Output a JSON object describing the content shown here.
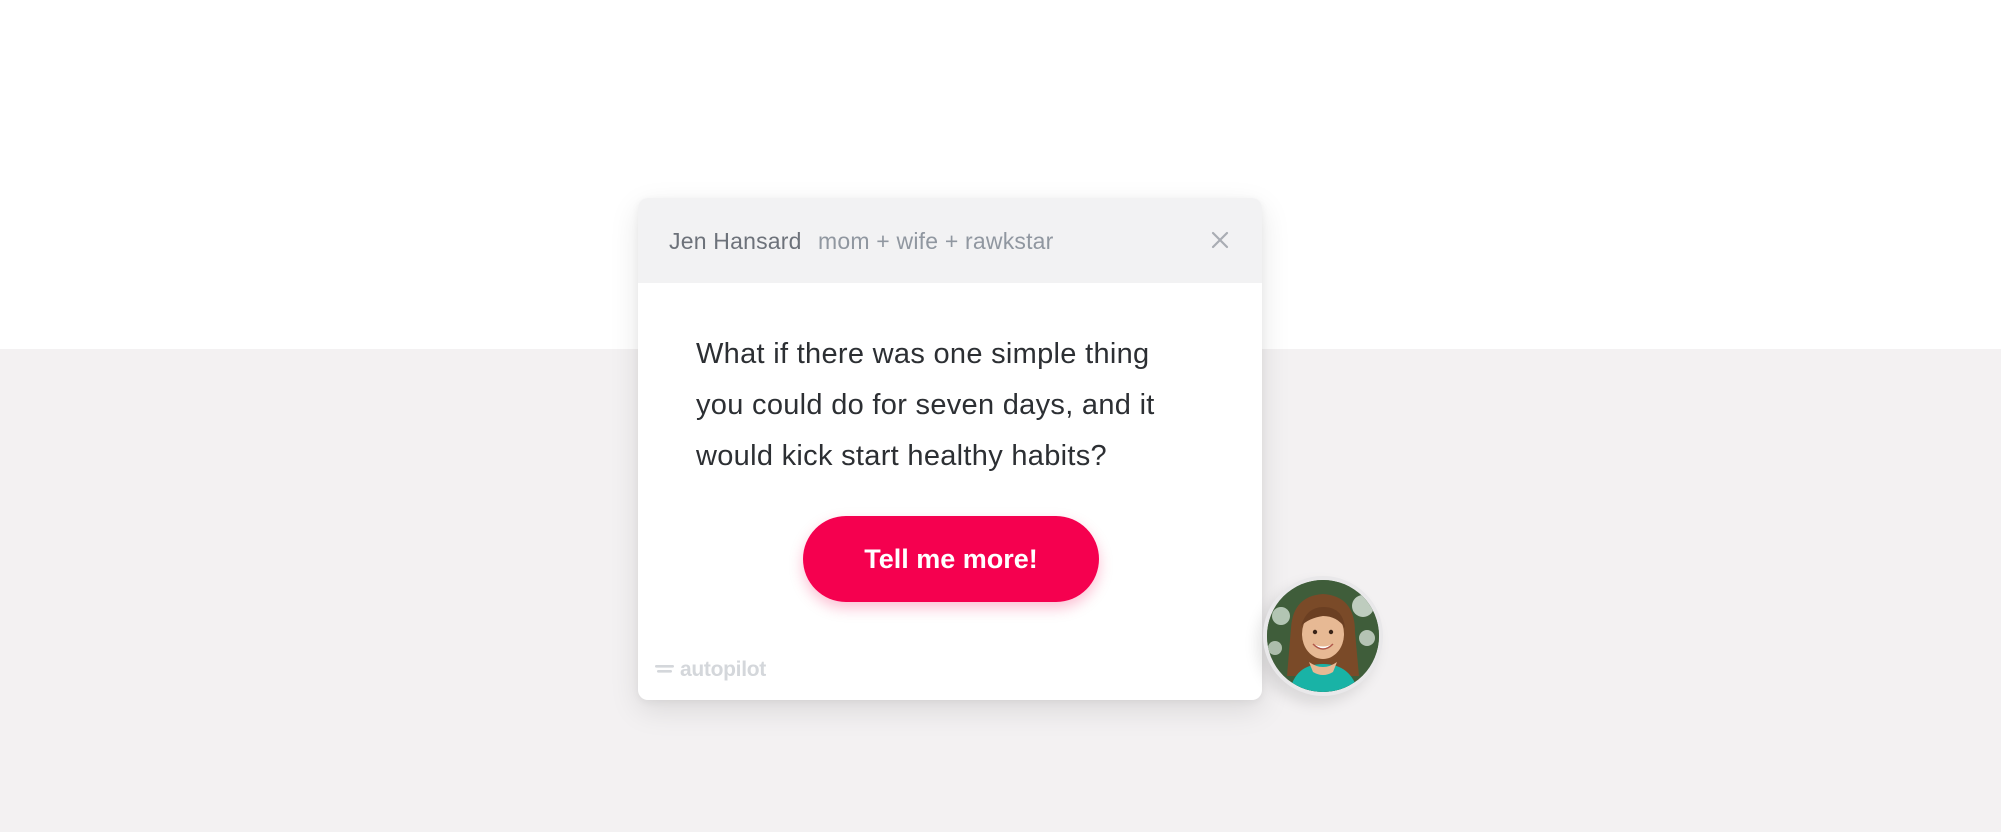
{
  "popup": {
    "sender_name": "Jen Hansard",
    "sender_tagline": "mom + wife + rawkstar",
    "close_icon": "close-icon",
    "message_lines": [
      "What if there was one simple thing",
      "you could do for seven days, and it",
      "would kick start healthy habits?"
    ],
    "cta_label": "Tell me more!",
    "branding": "autopilot",
    "avatar_icon": "avatar"
  },
  "colors": {
    "page_top": "#ffffff",
    "page_bottom": "#f3f1f2",
    "header_bg": "#f2f2f3",
    "cta": "#f5004f",
    "cta_text": "#ffffff",
    "message_text": "#2c2f33",
    "sender_name": "#6d727a",
    "tagline": "#9097a0",
    "branding": "#d4d7db"
  }
}
